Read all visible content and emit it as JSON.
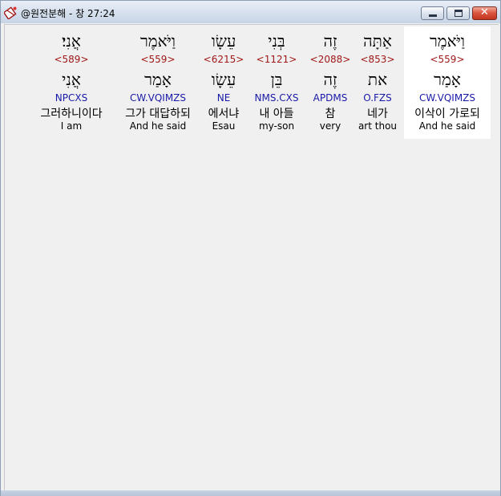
{
  "window": {
    "title": "@원전분해 - 창 27:24",
    "icon": "bible-app-icon",
    "controls": {
      "minimize": "minimize-icon",
      "maximize": "maximize-icon",
      "close_label": "✕"
    }
  },
  "columns": [
    {
      "hebrew_text": "אֲנִי׃",
      "strong": "<589>",
      "hebrew_lemma": "אֲנִי",
      "parse": "NPCXS",
      "korean": "그러하니이다",
      "english": "I am"
    },
    {
      "hebrew_text": "וַיֹּאמֶר",
      "strong": "<559>",
      "hebrew_lemma": "אָמַר",
      "parse": "CW.VQIMZS",
      "korean": "그가 대답하되",
      "english": "And he said"
    },
    {
      "hebrew_text": "עֵשָׂו",
      "strong": "<6215>",
      "hebrew_lemma": "עֵשָׂו",
      "parse": "NE",
      "korean": "에서냐",
      "english": "Esau"
    },
    {
      "hebrew_text": "בְּנִי",
      "strong": "<1121>",
      "hebrew_lemma": "בֵּן",
      "parse": "NMS.CXS",
      "korean": "내 아들",
      "english": "my-son"
    },
    {
      "hebrew_text": "זֶה",
      "strong": "<2088>",
      "hebrew_lemma": "זֶה",
      "parse": "APDMS",
      "korean": "참",
      "english": "very"
    },
    {
      "hebrew_text": "אַתָּה",
      "strong": "<853>",
      "hebrew_lemma": "את",
      "parse": "O.FZS",
      "korean": "네가",
      "english": "art thou"
    },
    {
      "hebrew_text": "וַיֹּאמֶר",
      "strong": "<559>",
      "hebrew_lemma": "אָמַר",
      "parse": "CW.VQIMZS",
      "korean": "이삭이 가로되",
      "english": "And he said"
    }
  ],
  "selected_column": 6
}
